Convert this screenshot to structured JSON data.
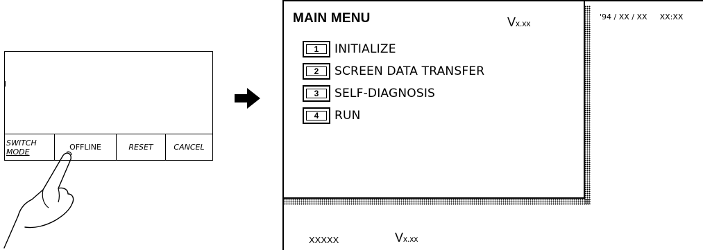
{
  "left_panel": {
    "softkeys": {
      "switch_mode_line1": "SWITCH",
      "switch_mode_line2": "MODE",
      "offline": "OFFLINE",
      "reset": "RESET",
      "cancel": "CANCEL"
    }
  },
  "main_menu": {
    "title": "MAIN MENU",
    "version_prefix": "V",
    "version_value": "x.xx",
    "items": [
      {
        "number": "1",
        "label": "INITIALIZE"
      },
      {
        "number": "2",
        "label": "SCREEN DATA TRANSFER"
      },
      {
        "number": "3",
        "label": "SELF-DIAGNOSIS"
      },
      {
        "number": "4",
        "label": "RUN"
      }
    ]
  },
  "status": {
    "date": "'94 / XX / XX",
    "time": "XX:XX"
  },
  "footer": {
    "code": "XXXXX",
    "version_prefix": "V",
    "version_value": "x.xx"
  },
  "icons": {
    "arrow": "right-arrow-icon",
    "hand": "pointing-hand-icon"
  }
}
